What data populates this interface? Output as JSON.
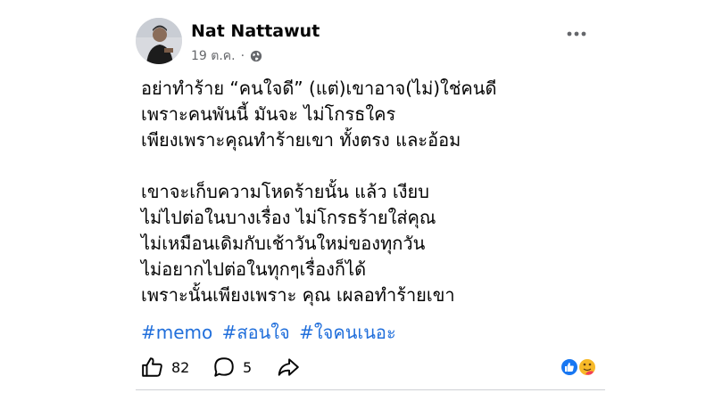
{
  "post": {
    "author": "Nat Nattawut",
    "date": "19 ต.ค.",
    "separator": "·",
    "privacy_icon": "globe-icon",
    "more_icon": "more-options-icon",
    "paragraphs": [
      [
        "อย่าทำร้าย “คนใจดี” (แต่)เขาอาจ(ไม่)ใช่คนดี",
        "เพราะคนพันนี้ มันจะ ไม่โกรธใคร",
        "เพียงเพราะคุณทำร้ายเขา ทั้งตรง และอ้อม"
      ],
      [
        "เขาจะเก็บความโหดร้ายนั้น แล้ว เงียบ",
        "ไม่ไปต่อในบางเรื่อง ไม่โกรธร้ายใส่คุณ",
        "ไม่เหมือนเดิมกับเช้าวันใหม่ของทุกวัน",
        "ไม่อยากไปต่อในทุกๆเรื่องก็ได้",
        "เพราะนั้นเพียงเพราะ คุณ เผลอทำร้ายเขา"
      ]
    ],
    "hashtags": [
      "#memo",
      "#สอนใจ",
      "#ใจคนเนอะ"
    ],
    "link_color": "#216fdb"
  },
  "actions": {
    "like_count": "82",
    "comment_count": "5",
    "like_icon": "thumbs-up-icon",
    "comment_icon": "comment-icon",
    "share_icon": "share-icon"
  },
  "reactions": {
    "icons": [
      "like-reaction-icon",
      "care-reaction-icon"
    ],
    "like_color": "#1877f2",
    "care_color": "#f7b928"
  }
}
